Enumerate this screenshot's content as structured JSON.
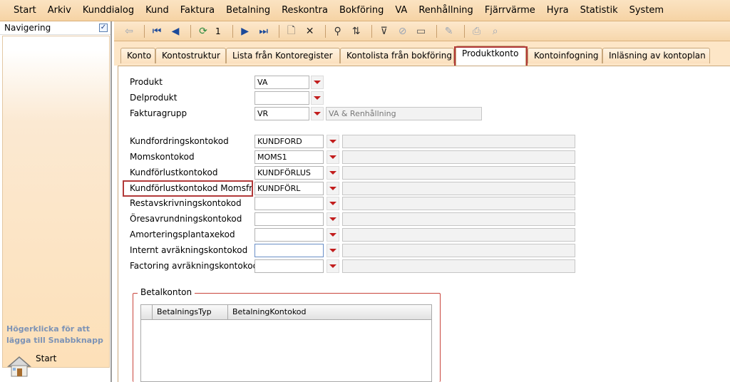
{
  "menu": [
    "Start",
    "Arkiv",
    "Kunddialog",
    "Kund",
    "Faktura",
    "Betalning",
    "Reskontra",
    "Bokföring",
    "VA",
    "Renhållning",
    "Fjärrvärme",
    "Hyra",
    "Statistik",
    "System"
  ],
  "nav": {
    "title": "Navigering",
    "check_glyph": "✓",
    "hint": "Högerklicka för att lägga till Snabbknapp",
    "start_label": "Start"
  },
  "toolbar": {
    "record_number": "1"
  },
  "tabs": [
    "Konto",
    "Kontostruktur",
    "Lista från Kontoregister",
    "Kontolista från bokföring",
    "Produktkonto",
    "Kontoinfogning",
    "Inläsning av kontoplan"
  ],
  "active_tab": "Produktkonto",
  "form": {
    "produkt": {
      "label": "Produkt",
      "value": "VA"
    },
    "delprodukt": {
      "label": "Delprodukt",
      "value": ""
    },
    "fakturagrupp": {
      "label": "Fakturagrupp",
      "value": "VR",
      "description": "VA & Renhållning"
    },
    "accounts": [
      {
        "label": "Kundfordringskontokod",
        "value": "KUNDFORD"
      },
      {
        "label": "Momskontokod",
        "value": "MOMS1"
      },
      {
        "label": "Kundförlustkontokod",
        "value": "KUNDFÖRLUS"
      },
      {
        "label": "Kundförlustkontokod Momsfritt",
        "value": "KUNDFÖRL"
      },
      {
        "label": "Restavskrivningskontokod",
        "value": ""
      },
      {
        "label": "Öresavrundningskontokod",
        "value": ""
      },
      {
        "label": "Amorteringsplantaxekod",
        "value": ""
      },
      {
        "label": "Internt avräkningskontokod",
        "value": ""
      },
      {
        "label": "Factoring avräkningskontokod",
        "value": ""
      }
    ]
  },
  "betalkonton": {
    "title": "Betalkonton",
    "columns": [
      "BetalningsTyp",
      "BetalningKontokod"
    ]
  },
  "colors": {
    "highlight": "#b23a3a",
    "dropdown_arrow": "#c21d1d"
  }
}
